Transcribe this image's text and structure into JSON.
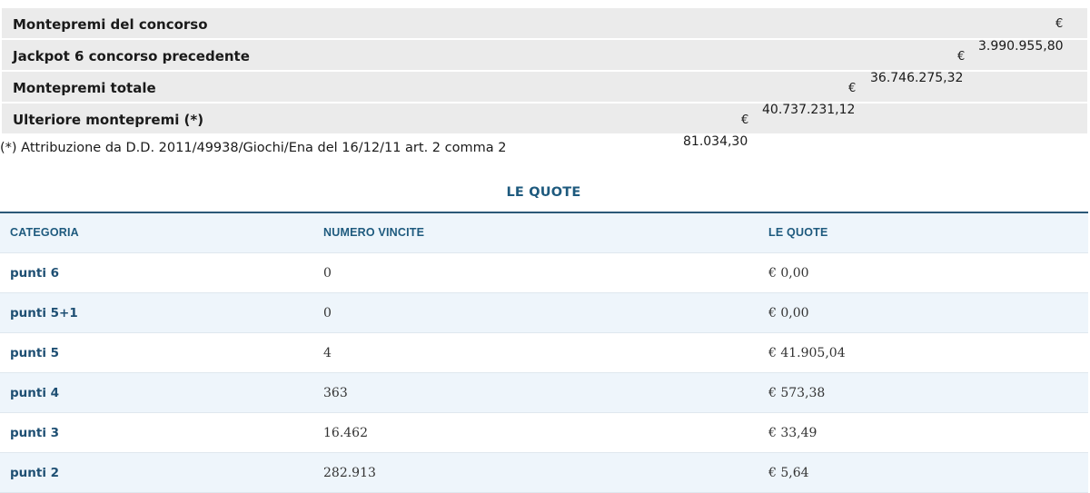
{
  "summary": {
    "rows": [
      {
        "label": "Montepremi del concorso",
        "currency": "€",
        "amount": ""
      },
      {
        "label": "Jackpot 6 concorso precedente",
        "currency": "€",
        "amount": "3.990.955,80"
      },
      {
        "label": "Montepremi totale",
        "currency": "€",
        "amount": "36.746.275,32"
      },
      {
        "label": "Ulteriore montepremi (*)",
        "currency": "€",
        "amount": "40.737.231,12"
      }
    ],
    "note": "(*) Attribuzione da D.D. 2011/49938/Giochi/Ena del 16/12/11 art. 2 comma 2",
    "note_amount": "81.034,30"
  },
  "quotes": {
    "title": "LE QUOTE",
    "headers": [
      "CATEGORIA",
      "NUMERO VINCITE",
      "LE QUOTE"
    ],
    "rows": [
      {
        "category": "punti 6",
        "wins": "0",
        "quota": "€ 0,00"
      },
      {
        "category": "punti 5+1",
        "wins": "0",
        "quota": "€ 0,00"
      },
      {
        "category": "punti 5",
        "wins": "4",
        "quota": "€ 41.905,04"
      },
      {
        "category": "punti 4",
        "wins": "363",
        "quota": "€ 573,38"
      },
      {
        "category": "punti 3",
        "wins": "16.462",
        "quota": "€ 33,49"
      },
      {
        "category": "punti 2",
        "wins": "282.913",
        "quota": "€ 5,64"
      }
    ]
  }
}
